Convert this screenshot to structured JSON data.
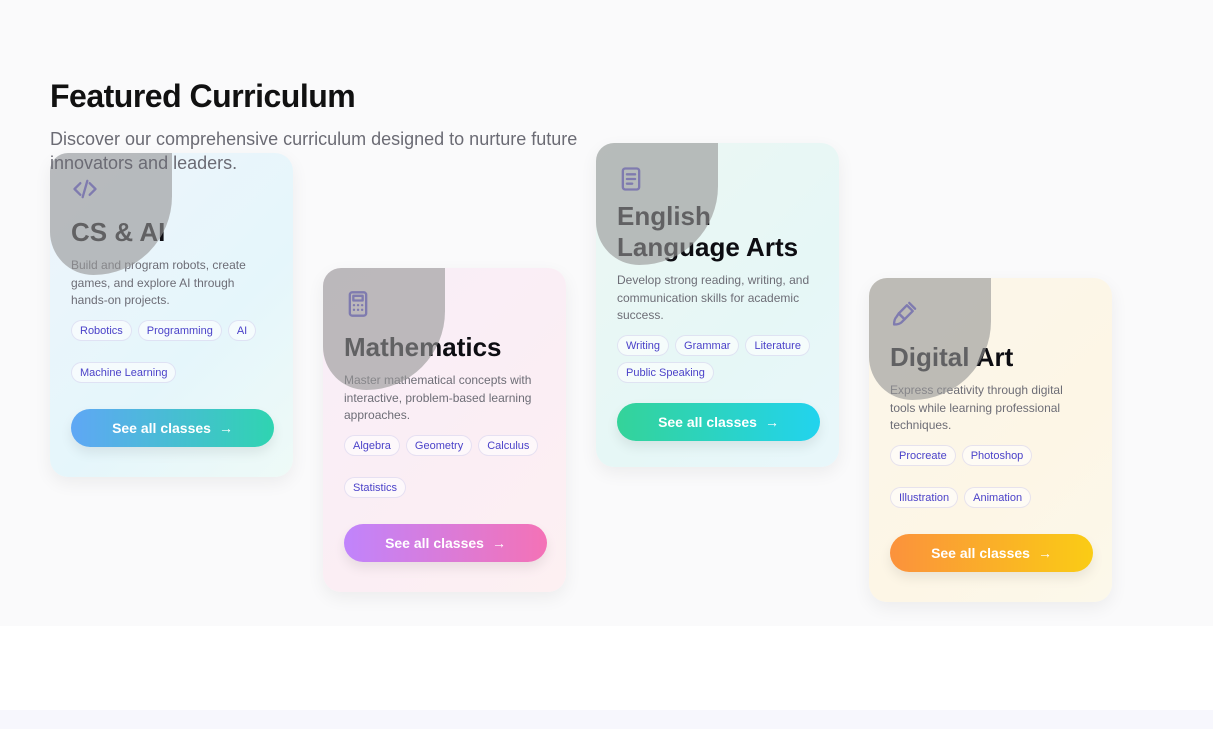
{
  "section": {
    "title": "Featured Curriculum",
    "subtitle": "Discover our comprehensive curriculum designed to nurture future innovators and leaders."
  },
  "cards": [
    {
      "icon": "code-icon",
      "title": "CS & AI",
      "description": "Build and program robots, create games, and explore AI through hands-on projects.",
      "tags": [
        "Robotics",
        "Programming",
        "AI",
        "Machine Learning"
      ],
      "button_label": "See all classes",
      "accent_colors": [
        "#5fa7f5",
        "#2fd4b1"
      ]
    },
    {
      "icon": "calculator-icon",
      "title": "Mathematics",
      "description": "Master mathematical concepts with interactive, problem-based learning approaches.",
      "tags": [
        "Algebra",
        "Geometry",
        "Calculus",
        "Statistics"
      ],
      "button_label": "See all classes",
      "accent_colors": [
        "#c084fc",
        "#f472b6"
      ]
    },
    {
      "icon": "book-icon",
      "title": "English Language Arts",
      "description": "Develop strong reading, writing, and communication skills for academic success.",
      "tags": [
        "Writing",
        "Grammar",
        "Literature",
        "Public Speaking"
      ],
      "button_label": "See all classes",
      "accent_colors": [
        "#34d399",
        "#22d3ee"
      ]
    },
    {
      "icon": "paintbrush-icon",
      "title": "Digital Art",
      "description": "Express creativity through digital tools while learning professional techniques.",
      "tags": [
        "Procreate",
        "Photoshop",
        "Illustration",
        "Animation"
      ],
      "button_label": "See all classes",
      "accent_colors": [
        "#fb923c",
        "#facc15"
      ]
    }
  ]
}
